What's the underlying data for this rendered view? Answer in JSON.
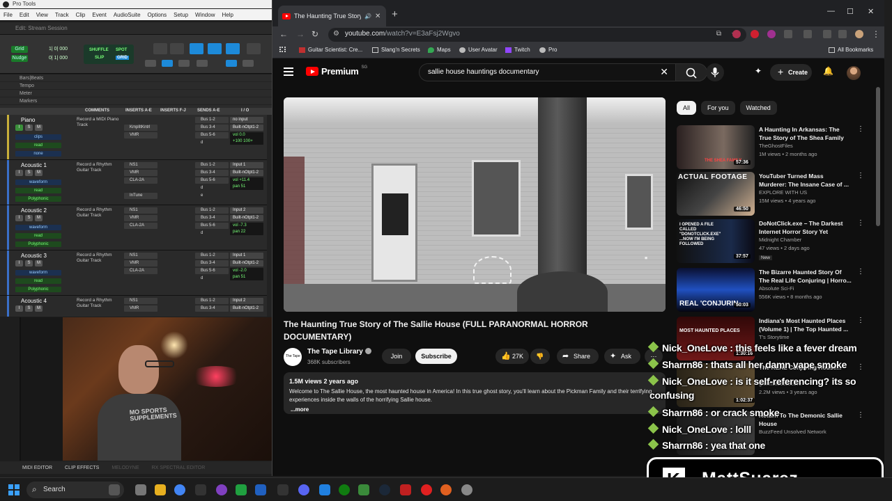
{
  "protools": {
    "app_title": "Pro Tools",
    "menu": [
      "File",
      "Edit",
      "View",
      "Track",
      "Clip",
      "Event",
      "AudioSuite",
      "Options",
      "Setup",
      "Window",
      "Help"
    ],
    "session_title": "Edit: Stream Session",
    "toolbar": {
      "grid_label": "Grid",
      "nudge_label": "Nudge",
      "grid_value": "1| 0| 000",
      "nudge_value": "0| 1| 000",
      "mode_shuffle": "SHUFFLE",
      "mode_spot": "SPOT",
      "mode_slip": "SLIP",
      "mode_grid": "GRID"
    },
    "rulers": [
      "Bars|Beats",
      "Tempo",
      "Meter",
      "Markers"
    ],
    "columns": [
      "COMMENTS",
      "INSERTS A-E",
      "INSERTS F-J",
      "SENDS A-E",
      "I / O"
    ],
    "tracks": [
      {
        "name": "Piano",
        "comment": "Record a MIDI Piano Track",
        "view": "clips",
        "auto": "read",
        "extra": "none",
        "inserts": [
          "",
          "KmplItKntrl",
          "VMR",
          ""
        ],
        "sends": [
          "Bus 1-2",
          "Bus 3-4",
          "Bus 5-6",
          "d"
        ],
        "io": [
          "no input",
          "Built-nOtpt1-2"
        ],
        "vol": "vol      0.0",
        "pan": "+100   100+"
      },
      {
        "name": "Acoustic 1",
        "comment": "Record a Rhythm Guitar Track",
        "view": "waveform",
        "auto": "read",
        "extra": "Polyphonic",
        "inserts": [
          "NS1",
          "VMR",
          "CLA-2A",
          "",
          "InTune"
        ],
        "sends": [
          "Bus 1-2",
          "Bus 3-4",
          "Bus 5-6",
          "d",
          "e"
        ],
        "io": [
          "Input 1",
          "Built-nOtpt1-2"
        ],
        "vol": "vol   +11.4",
        "pan": "pan      51"
      },
      {
        "name": "Acoustic 2",
        "comment": "Record a Rhythm Guitar Track",
        "view": "waveform",
        "auto": "read",
        "extra": "Polyphonic",
        "inserts": [
          "NS1",
          "VMR",
          "CLA-2A",
          ""
        ],
        "sends": [
          "Bus 1-2",
          "Bus 3-4",
          "Bus 5-6",
          "d"
        ],
        "io": [
          "Input 2",
          "Built-nOtpt1-2"
        ],
        "vol": "vol    -7.3",
        "pan": "pan      22"
      },
      {
        "name": "Acoustic 3",
        "comment": "Record a Rhythm Guitar Track",
        "view": "waveform",
        "auto": "read",
        "extra": "Polyphonic",
        "inserts": [
          "NS1",
          "VMR",
          "CLA-2A",
          ""
        ],
        "sends": [
          "Bus 1-2",
          "Bus 3-4",
          "Bus 5-6",
          "d"
        ],
        "io": [
          "Input 1",
          "Built-nOtpt1-2"
        ],
        "vol": "vol    -2.0",
        "pan": "pan      51"
      },
      {
        "name": "Acoustic 4",
        "comment": "Record a Rhythm Guitar Track",
        "view": "",
        "auto": "",
        "extra": "",
        "inserts": [
          "NS1",
          "VMR"
        ],
        "sends": [
          "Bus 1-2",
          "Bus 3-4"
        ],
        "io": [
          "Input 2",
          "Built-nOtpt1-2"
        ],
        "vol": "",
        "pan": ""
      }
    ],
    "bottom_tabs": [
      "MIDI EDITOR",
      "CLIP EFFECTS",
      "MELODYNE",
      "RX SPECTRAL EDITOR"
    ],
    "webcam_shirt": "MO SPORTS SUPPLEMENTS"
  },
  "chrome": {
    "tab_title": "The Haunting True Story of",
    "url_host": "youtube.com",
    "url_path": "/watch?v=E3aFsj2Wgvo",
    "bookmarks": [
      "Guitar Scientist: Cre...",
      "Slang'n Secrets",
      "Maps",
      "User Avatar",
      "Twitch",
      "Pro"
    ],
    "all_bookmarks": "All Bookmarks"
  },
  "youtube": {
    "logo_text": "Premium",
    "logo_region": "SG",
    "search_query": "sallie house hauntings documentary",
    "create_label": "Create",
    "video_title": "The Haunting True Story of The Sallie House (FULL PARANORMAL HORROR DOCUMENTARY)",
    "channel_name": "The Tape Library",
    "subscribers": "368K subscribers",
    "join_label": "Join",
    "subscribe_label": "Subscribe",
    "likes": "27K",
    "share_label": "Share",
    "ask_label": "Ask",
    "desc_meta": "1.5M views  2 years ago",
    "desc_text": "Welcome to The Sallie House, the most haunted house in America! In this true ghost story, you'll learn about the Pickman Family and their terrifying experiences inside the walls of the horrifying Sallie house.",
    "desc_more": "...more",
    "chips": [
      "All",
      "For you",
      "Watched"
    ],
    "recommendations": [
      {
        "title": "A Haunting In Arkansas: The True Story of The Shea Family",
        "channel": "TheGhostFiles",
        "meta": "1M views • 2 months ago",
        "duration": "57:36",
        "thumb_text": "THE SHEA FAMILY",
        "badge": ""
      },
      {
        "title": "YouTuber Turned Mass Murderer: The Insane Case of ...",
        "channel": "EXPLORE WITH US",
        "meta": "15M views • 4 years ago",
        "duration": "46:50",
        "thumb_text": "ACTUAL FOOTAGE",
        "badge": ""
      },
      {
        "title": "DoNotClick.exe – The Darkest Internet Horror Story Yet",
        "channel": "Midnight Chamber",
        "meta": "47 views • 2 days ago",
        "duration": "37:57",
        "thumb_text": "I OPENED A FILE CALLED \"DONOTCLICK.EXE\" ...NOW I'M BEING FOLLOWED",
        "badge": "New"
      },
      {
        "title": "The Bizarre Haunted Story Of The Real Life Conjuring | Horro...",
        "channel": "Absolute Sci-Fi",
        "meta": "556K views • 8 months ago",
        "duration": "50:03",
        "thumb_text": "REAL 'CONJURIN",
        "badge": ""
      },
      {
        "title": "Indiana's Most Haunted Places (Volume 1) | The Top Haunted ...",
        "channel": "T's Storytime",
        "meta": "",
        "duration": "1:30:16",
        "thumb_text": "MOST HAUNTED PLACES",
        "badge": ""
      },
      {
        "title": "The REAL Conjuring House...",
        "channel": "grimmlifecollective",
        "meta": "2.2M views • 3 years ago",
        "duration": "1:02:37",
        "thumb_text": "",
        "badge": ""
      },
      {
        "title": "Return To The Demonic Sallie House",
        "channel": "BuzzFeed Unsolved Network",
        "meta": "",
        "duration": "",
        "thumb_text": "",
        "badge": ""
      }
    ]
  },
  "chat": [
    {
      "user": "Nick_OneLove",
      "text": "this feels like a fever dream"
    },
    {
      "user": "Sharrn86",
      "text": "thats all her damn vape smoke"
    },
    {
      "user": "Nick_OneLove",
      "text": "is it self-referencing? its so"
    },
    {
      "user": "",
      "text": "confusing"
    },
    {
      "user": "Sharrn86",
      "text": "or crack smoke"
    },
    {
      "user": "Nick_OneLove",
      "text": "lolll"
    },
    {
      "user": "Sharrn86",
      "text": "yea that one"
    }
  ],
  "streamer_badge": "MattSuarez",
  "taskbar": {
    "search_label": "Search"
  },
  "colors": {
    "yt_red": "#ff0000",
    "pt_blue": "#1d8ad9",
    "chat_diamond": "#8bc34a"
  }
}
